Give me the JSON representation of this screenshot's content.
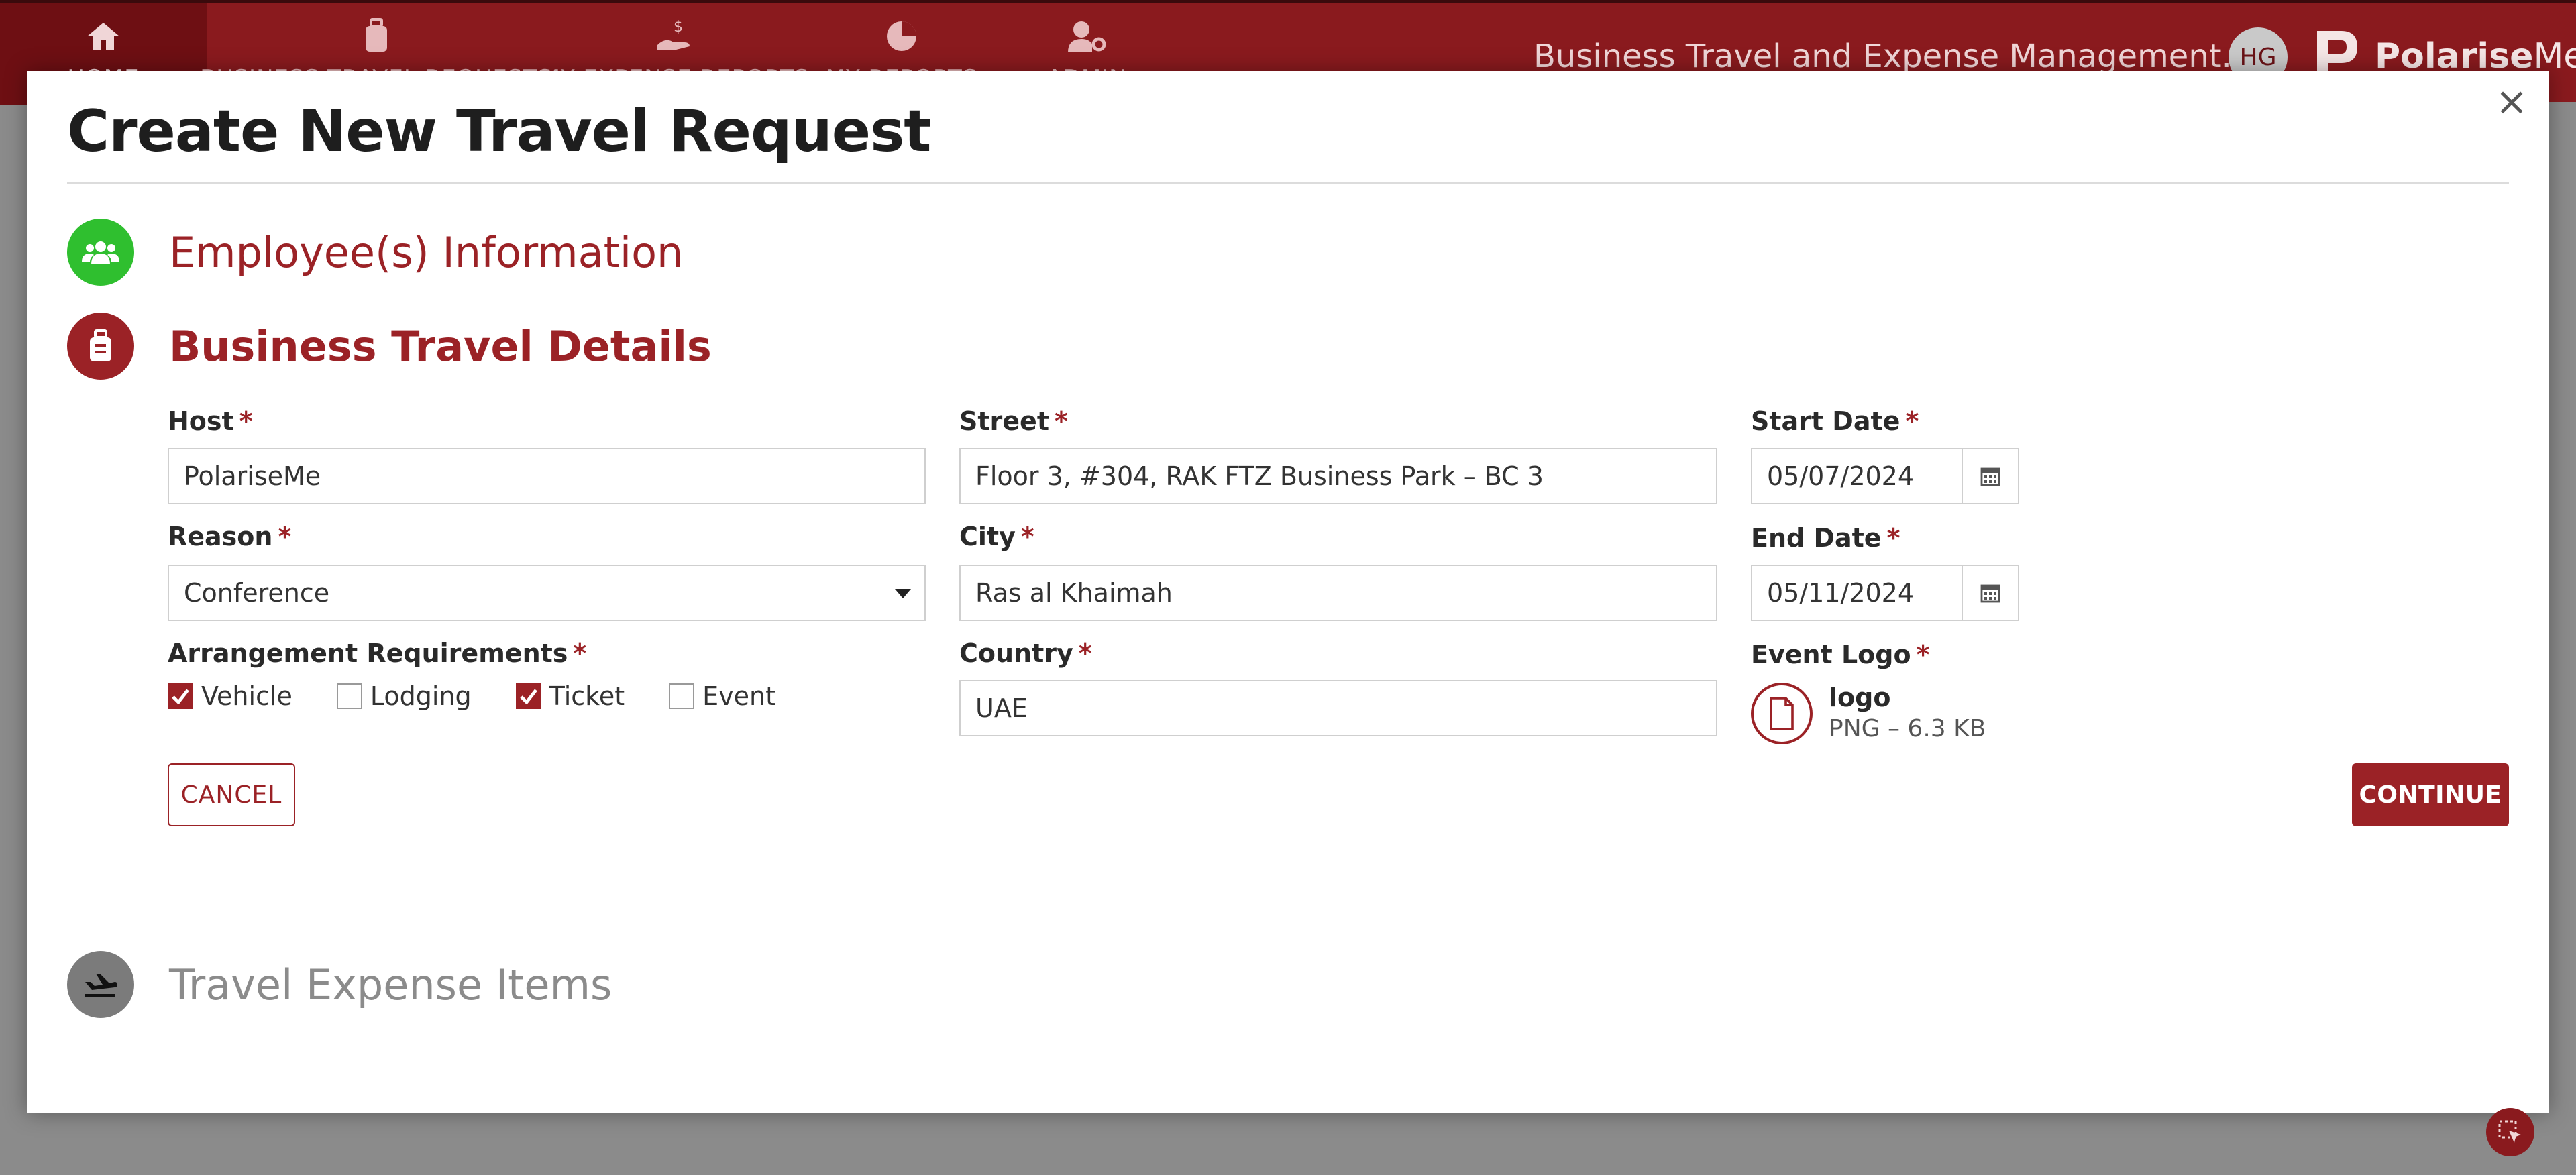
{
  "nav": {
    "items": [
      {
        "label": "HOME",
        "icon": "home-icon"
      },
      {
        "label": "BUSINESS TRAVEL REQUESTS",
        "icon": "luggage-icon"
      },
      {
        "label": "MY EXPENSE REPORTS",
        "icon": "hand-dollar-icon"
      },
      {
        "label": "MY REPORTS",
        "icon": "pie-chart-icon"
      },
      {
        "label": "ADMIN",
        "icon": "user-gear-icon"
      }
    ],
    "app_switcher": "Business Travel and Expense Management...",
    "avatar_initials": "HG",
    "brand_bold": "Polarise",
    "brand_light": "Me"
  },
  "modal": {
    "title": "Create New Travel Request",
    "close": "×",
    "steps": [
      {
        "label": "Employee(s) Information",
        "icon": "users-icon",
        "state": "complete"
      },
      {
        "label": "Business Travel Details",
        "icon": "suitcase-icon",
        "state": "active"
      },
      {
        "label": "Travel Expense Items",
        "icon": "plane-icon",
        "state": "pending"
      }
    ]
  },
  "form": {
    "required_mark": "*",
    "host": {
      "label": "Host",
      "value": "PolariseMe"
    },
    "reason": {
      "label": "Reason",
      "value": "Conference"
    },
    "arrangements": {
      "label": "Arrangement Requirements",
      "options": [
        {
          "label": "Vehicle",
          "checked": true
        },
        {
          "label": "Lodging",
          "checked": false
        },
        {
          "label": "Ticket",
          "checked": true
        },
        {
          "label": "Event",
          "checked": false
        }
      ]
    },
    "street": {
      "label": "Street",
      "value": "Floor 3, #304, RAK FTZ Business Park – BC 3"
    },
    "city": {
      "label": "City",
      "value": "Ras al Khaimah"
    },
    "country": {
      "label": "Country",
      "value": "UAE"
    },
    "start_date": {
      "label": "Start Date",
      "value": "05/07/2024"
    },
    "end_date": {
      "label": "End Date",
      "value": "05/11/2024"
    },
    "event_logo": {
      "label": "Event Logo",
      "file_name": "logo",
      "file_meta": "PNG – 6.3 KB"
    },
    "cancel_label": "CANCEL",
    "continue_label": "CONTINUE"
  },
  "colors": {
    "brand": "#9b2226",
    "nav_bg": "#8a1a1e",
    "step_complete": "#2fbf2f",
    "step_pending": "#7b7b7b"
  }
}
